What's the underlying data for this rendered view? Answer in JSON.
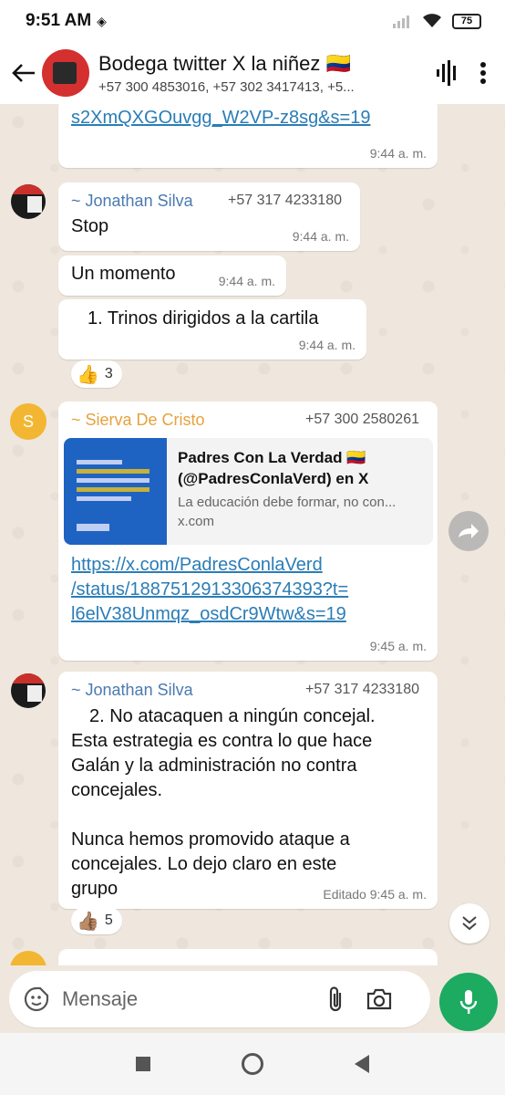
{
  "status_bar": {
    "time": "9:51 AM",
    "battery": "75"
  },
  "header": {
    "title": "Bodega twitter X la niñez 🇨🇴",
    "subtitle": "+57 300 4853016, +57 302 3417413, +5..."
  },
  "messages": {
    "m0": {
      "link_part": "s2XmQXGOuvgg_W2VP-z8sg&s=19",
      "time": "9:44 a. m."
    },
    "m1": {
      "sender": "~ Jonathan Silva",
      "phone": "+57 317 4233180",
      "text": "Stop",
      "time": "9:44 a. m."
    },
    "m2": {
      "text": "Un momento",
      "time": "9:44 a. m."
    },
    "m3": {
      "text": "1. Trinos dirigidos a la cartila",
      "time": "9:44 a. m."
    },
    "m3_reaction": {
      "emoji": "👍",
      "count": "3"
    },
    "m4": {
      "avatar_letter": "S",
      "sender": "~ Sierva De Cristo",
      "phone": "+57 300 2580261",
      "preview_title": "Padres Con La Verdad 🇨🇴 (@PadresConlaVerd) en X",
      "preview_desc": "La educación debe formar, no con...",
      "preview_domain": "x.com",
      "link_line1": "https://x.com/PadresConlaVerd",
      "link_line2": "/status/1887512913306374393?t=",
      "link_line3": "l6elV38Unmqz_osdCr9Wtw&s=19",
      "time": "9:45 a. m."
    },
    "m5": {
      "sender": "~ Jonathan Silva",
      "phone": "+57 317 4233180",
      "para1_line1": "2. No atacaquen a ningún concejal.",
      "para1_line2": "Esta estrategia es contra lo que hace",
      "para1_line3": "Galán y la administración no contra",
      "para1_line4": "concejales.",
      "para2_line1": "Nunca hemos promovido ataque a",
      "para2_line2": "concejales. Lo dejo claro en este",
      "para2_line3": "grupo",
      "edited_time": "Editado 9:45 a. m."
    },
    "m5_reaction": {
      "emoji": "👍🏽",
      "count": "5"
    }
  },
  "input": {
    "placeholder": "Mensaje"
  },
  "colors": {
    "accent_green": "#1daa61",
    "link_blue": "#2a7db6",
    "sender_blue": "#4a7ab0",
    "sender_orange": "#e6a23c"
  },
  "icons": [
    "back-arrow-icon",
    "audio-wave-icon",
    "more-vert-icon",
    "forward-icon",
    "chevron-double-down-icon",
    "emoji-sticker-icon",
    "attach-icon",
    "camera-icon",
    "mic-icon"
  ]
}
